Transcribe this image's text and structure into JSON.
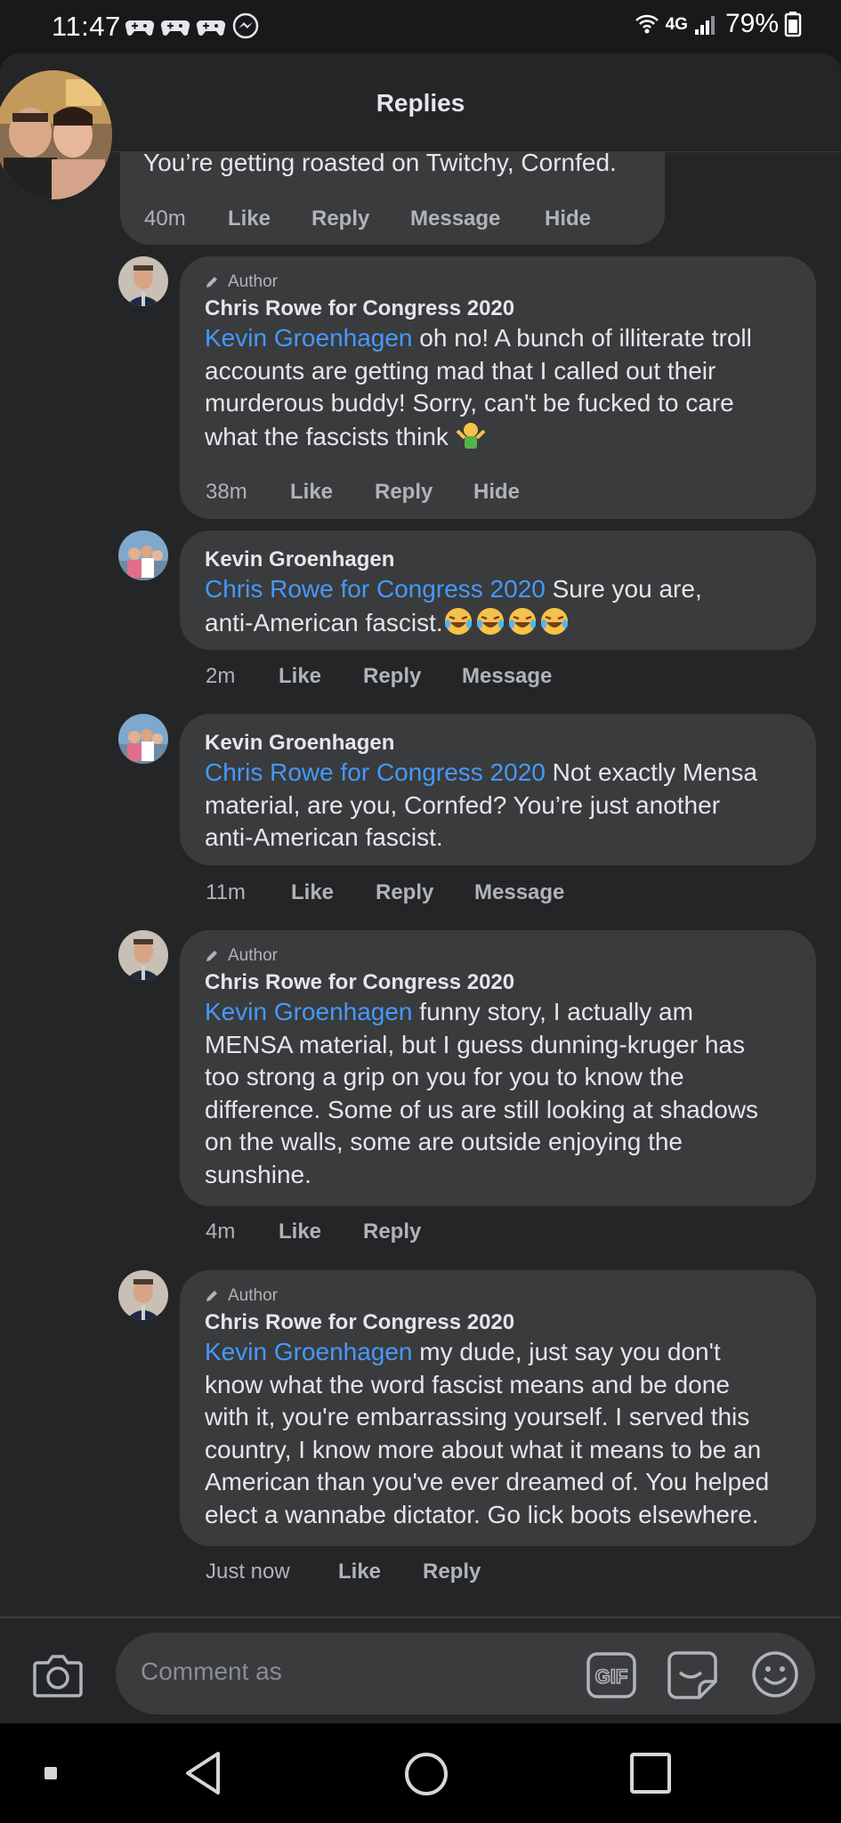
{
  "status_bar": {
    "time": "11:47",
    "network": "4G",
    "battery": "79%"
  },
  "panel": {
    "title": "Replies"
  },
  "parent_comment": {
    "text": "You’re getting roasted on Twitchy, Cornfed.",
    "timestamp": "40m",
    "actions": [
      "Like",
      "Reply",
      "Message",
      "Hide"
    ]
  },
  "replies": [
    {
      "is_author": true,
      "author_label": "Author",
      "name": "Chris Rowe for Congress 2020",
      "mention": "Kevin Groenhagen",
      "lines": [
        " oh no! A bunch of illiterate troll",
        "accounts are getting mad that I called out their",
        "murderous buddy! Sorry, can't be fucked to care",
        "what the fascists think "
      ],
      "timestamp": "38m",
      "actions": [
        "Like",
        "Reply",
        "Hide"
      ]
    },
    {
      "is_author": false,
      "name": "Kevin Groenhagen",
      "mention": "Chris Rowe for Congress 2020",
      "lines": [
        " Sure you are,",
        "anti-American fascist."
      ],
      "timestamp": "2m",
      "actions": [
        "Like",
        "Reply",
        "Message"
      ]
    },
    {
      "is_author": false,
      "name": "Kevin Groenhagen",
      "mention": "Chris Rowe for Congress 2020",
      "lines": [
        " Not exactly Mensa",
        "material, are you, Cornfed? You’re just another",
        "anti-American fascist."
      ],
      "timestamp": "11m",
      "actions": [
        "Like",
        "Reply",
        "Message"
      ]
    },
    {
      "is_author": true,
      "author_label": "Author",
      "name": "Chris Rowe for Congress 2020",
      "mention": "Kevin Groenhagen",
      "lines": [
        " funny story, I actually am",
        "MENSA material, but I guess dunning-kruger has",
        "too strong a grip on you for you to know the",
        "difference. Some of us are still looking at shadows",
        "on the walls, some are outside enjoying the",
        "sunshine."
      ],
      "timestamp": "4m",
      "actions": [
        "Like",
        "Reply"
      ]
    },
    {
      "is_author": true,
      "author_label": "Author",
      "name": "Chris Rowe for Congress 2020",
      "mention": "Kevin Groenhagen",
      "lines": [
        " my dude, just say you don't",
        "know what the word fascist means and be done",
        "with it, you're embarrassing yourself. I served this",
        "country, I know more about what it means to be an",
        "American than you've ever dreamed of. You helped",
        "elect a wannabe dictator. Go lick boots elsewhere."
      ],
      "timestamp": "Just now",
      "actions": [
        "Like",
        "Reply"
      ]
    }
  ],
  "composer": {
    "placeholder": "Comment as"
  },
  "icons": {
    "camera": "camera-icon",
    "gif": "gif-icon",
    "sticker": "sticker-icon",
    "emoji": "smile-icon",
    "author_badge": "pencil-icon"
  },
  "colors": {
    "background": "#18191a",
    "panel": "#242526",
    "bubble": "#3a3b3c",
    "mention": "#4599ff",
    "meta": "#b0b3b8"
  }
}
